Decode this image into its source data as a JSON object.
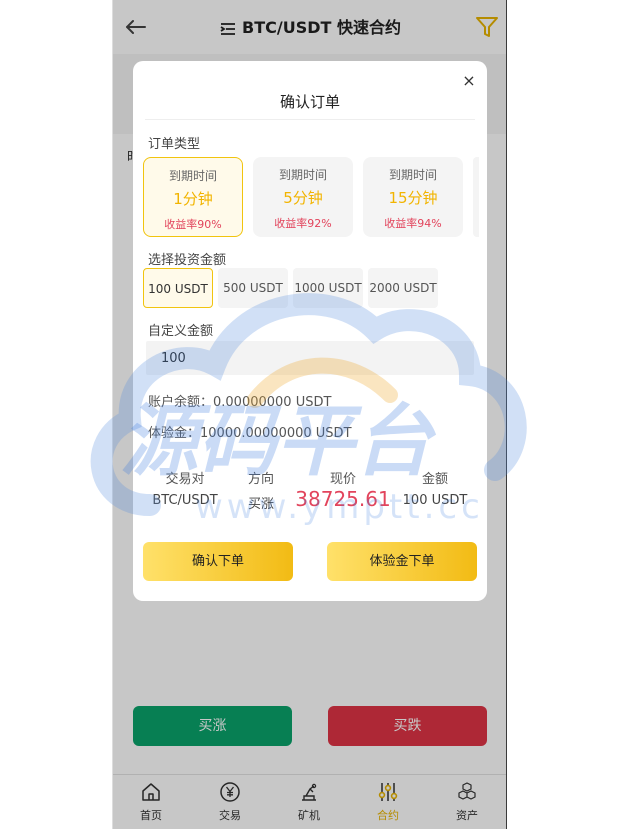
{
  "header": {
    "title": "BTC/USDT 快速合约"
  },
  "page": {
    "side_char": "时"
  },
  "modal": {
    "close_glyph": "×",
    "title": "确认订单",
    "order_type_label": "订单类型",
    "order_types": [
      {
        "time_label": "到期时间",
        "duration": "1分钟",
        "rate": "收益率90%"
      },
      {
        "time_label": "到期时间",
        "duration": "5分钟",
        "rate": "收益率92%"
      },
      {
        "time_label": "到期时间",
        "duration": "15分钟",
        "rate": "收益率94%"
      }
    ],
    "amount_label": "选择投资金额",
    "amounts": [
      "100 USDT",
      "500 USDT",
      "1000 USDT",
      "2000 USDT"
    ],
    "custom_label": "自定义金额",
    "custom_value": "100",
    "balance": "账户余额：0.00000000 USDT",
    "trial": "体验金：10000.00000000 USDT",
    "summary": {
      "headers": [
        "交易对",
        "方向",
        "现价",
        "金额"
      ],
      "pair": "BTC/USDT",
      "direction": "买涨",
      "price": "38725.61",
      "amount": "100 USDT"
    },
    "confirm_label": "确认下单",
    "trial_order_label": "体验金下单"
  },
  "actions": {
    "buy_up": "买涨",
    "buy_down": "买跌"
  },
  "tabbar": {
    "items": [
      "首页",
      "交易",
      "矿机",
      "合约",
      "资产"
    ]
  },
  "watermark": {
    "text": "源码平台",
    "url": "www.ymptt.cc"
  },
  "colors": {
    "accent": "#f2b400",
    "rise": "#0aa36b",
    "fall": "#df3446",
    "rate": "#e2445c"
  }
}
